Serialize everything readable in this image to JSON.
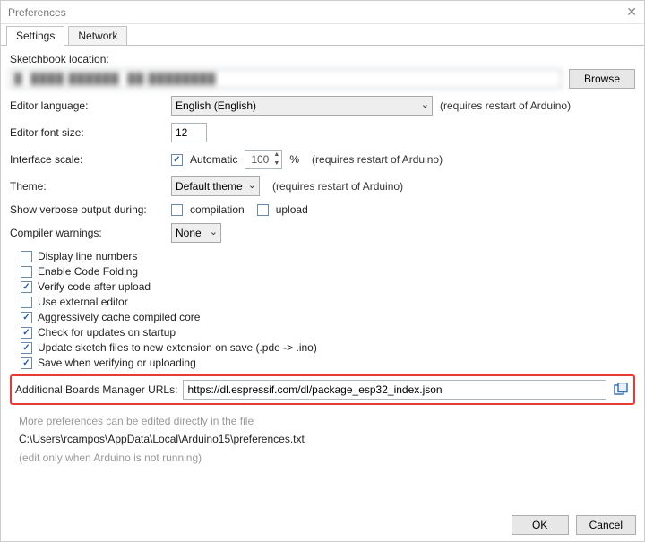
{
  "window": {
    "title": "Preferences"
  },
  "tabs": {
    "settings": "Settings",
    "network": "Network"
  },
  "labels": {
    "sketchbook": "Sketchbook location:",
    "editorLanguage": "Editor language:",
    "editorFontSize": "Editor font size:",
    "interfaceScale": "Interface scale:",
    "theme": "Theme:",
    "verbose": "Show verbose output during:",
    "compilerWarnings": "Compiler warnings:",
    "additionalUrls": "Additional Boards Manager URLs:"
  },
  "values": {
    "sketchbookPath": "█  ████ ██████  ██ ████████",
    "language": "English (English)",
    "fontSize": "12",
    "scaleAuto": true,
    "scaleValue": "100",
    "theme": "Default theme",
    "compilerWarnings": "None",
    "additionalUrl": "https://dl.espressif.com/dl/package_esp32_index.json"
  },
  "hints": {
    "restart": "(requires restart of Arduino)",
    "percent": "%"
  },
  "verbose": {
    "compilation": {
      "label": "compilation",
      "checked": false
    },
    "upload": {
      "label": "upload",
      "checked": false
    }
  },
  "checkboxes": {
    "autoScale": {
      "label": "Automatic",
      "checked": true
    },
    "displayLineNumbers": {
      "label": "Display line numbers",
      "checked": false
    },
    "enableCodeFolding": {
      "label": "Enable Code Folding",
      "checked": false
    },
    "verifyAfterUpload": {
      "label": "Verify code after upload",
      "checked": true
    },
    "externalEditor": {
      "label": "Use external editor",
      "checked": false
    },
    "aggressiveCache": {
      "label": "Aggressively cache compiled core",
      "checked": true
    },
    "checkUpdates": {
      "label": "Check for updates on startup",
      "checked": true
    },
    "updateExt": {
      "label": "Update sketch files to new extension on save (.pde -> .ino)",
      "checked": true
    },
    "saveOnVerify": {
      "label": "Save when verifying or uploading",
      "checked": true
    }
  },
  "footer": {
    "line1": "More preferences can be edited directly in the file",
    "line2": "C:\\Users\\rcampos\\AppData\\Local\\Arduino15\\preferences.txt",
    "line3": "(edit only when Arduino is not running)"
  },
  "buttons": {
    "browse": "Browse",
    "ok": "OK",
    "cancel": "Cancel"
  }
}
